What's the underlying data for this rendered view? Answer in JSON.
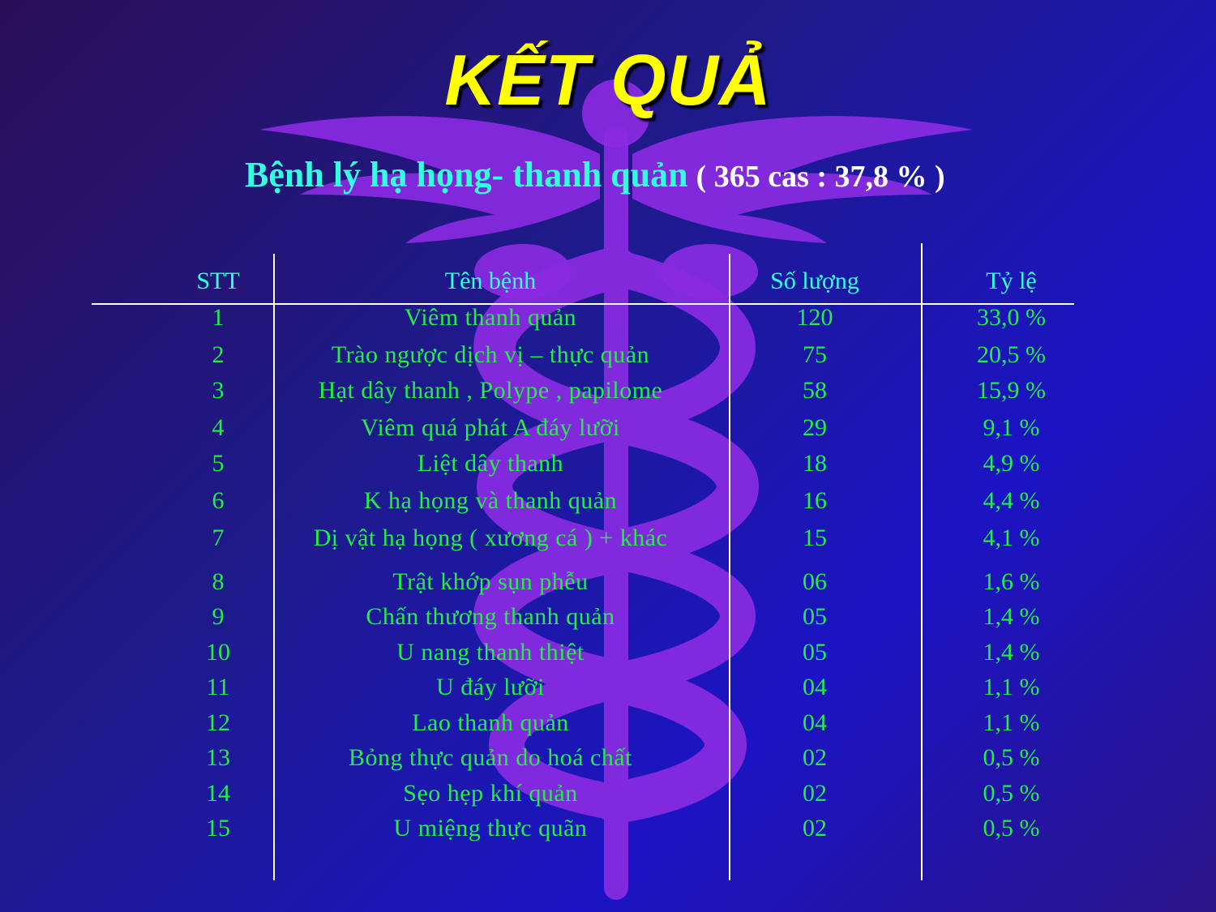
{
  "slide": {
    "title": "KẾT QUẢ",
    "subtitle": "Bệnh lý hạ họng- thanh quản",
    "subtitle_extra": "(  365 cas : 37,8 % )",
    "background_colors": [
      "#2a0f57",
      "#1c14c4"
    ],
    "emblem_icon": "caduceus-icon",
    "emblem_color": "#8a2be2"
  },
  "table": {
    "headers": {
      "stt": "STT",
      "name": "Tên bệnh",
      "quantity": "Số lượng",
      "rate": "Tỷ lệ"
    },
    "rows": [
      {
        "stt": "1",
        "name": "Viêm thanh quản",
        "quantity": "120",
        "rate": "33,0 %"
      },
      {
        "stt": "2",
        "name": "Trào ngược dịch vị – thực quản",
        "quantity": "75",
        "rate": "20,5 %"
      },
      {
        "stt": "3",
        "name": "Hạt dây thanh ,  Polype , papilome",
        "quantity": "58",
        "rate": "15,9 %"
      },
      {
        "stt": "4",
        "name": "Viêm quá phát A đáy lưỡi",
        "quantity": "29",
        "rate": "9,1 %"
      },
      {
        "stt": "5",
        "name": "Liệt dây thanh",
        "quantity": "18",
        "rate": "4,9 %"
      },
      {
        "stt": "6",
        "name": "K hạ họng và thanh quản",
        "quantity": "16",
        "rate": "4,4 %"
      },
      {
        "stt": "7",
        "name": "Dị vật hạ họng ( xương cá  ) + khác",
        "quantity": "15",
        "rate": "4,1 %"
      },
      {
        "stt": "8",
        "name": "Trật khớp sụn phễu",
        "quantity": "06",
        "rate": "1,6 %"
      },
      {
        "stt": "9",
        "name": "Chấn thương thanh quản",
        "quantity": "05",
        "rate": "1,4 %"
      },
      {
        "stt": "10",
        "name": "U nang thanh thiệt",
        "quantity": "05",
        "rate": "1,4 %"
      },
      {
        "stt": "11",
        "name": "U đáy lưỡi",
        "quantity": "04",
        "rate": "1,1 %"
      },
      {
        "stt": "12",
        "name": "Lao thanh quản",
        "quantity": "04",
        "rate": "1,1 %"
      },
      {
        "stt": "13",
        "name": "Bỏng thực quản do hoá chất",
        "quantity": "02",
        "rate": "0,5 %"
      },
      {
        "stt": "14",
        "name": "Sẹo hẹp khí  quản",
        "quantity": "02",
        "rate": "0,5 %"
      },
      {
        "stt": "15",
        "name": "U miệng thực quãn",
        "quantity": "02",
        "rate": "0,5 %"
      }
    ]
  }
}
